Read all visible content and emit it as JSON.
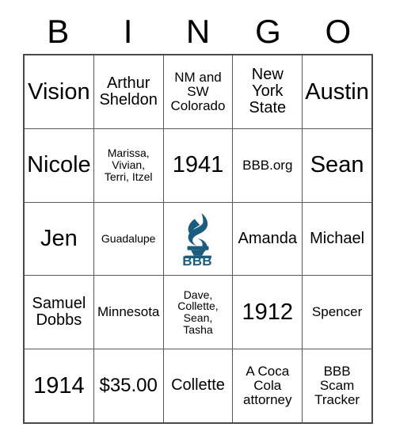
{
  "card": {
    "headers": [
      "B",
      "I",
      "N",
      "G",
      "O"
    ],
    "free_space": {
      "icon": "bbb-torch-logo",
      "wordmark": "BBB",
      "color": "#1b5d80"
    },
    "rows": [
      [
        {
          "text": "Vision",
          "size": "fs-xl"
        },
        {
          "text": "Arthur\nSheldon",
          "size": "fs-md"
        },
        {
          "text": "NM and\nSW\nColorado",
          "size": "fs-sm"
        },
        {
          "text": "New\nYork\nState",
          "size": "fs-md"
        },
        {
          "text": "Austin",
          "size": "fs-xl"
        }
      ],
      [
        {
          "text": "Nicole",
          "size": "fs-xl"
        },
        {
          "text": "Marissa,\nVivian,\nTerri, Itzel",
          "size": "fs-xs"
        },
        {
          "text": "1941",
          "size": "fs-xl"
        },
        {
          "text": "BBB.org",
          "size": "fs-sm"
        },
        {
          "text": "Sean",
          "size": "fs-xl"
        }
      ],
      [
        {
          "text": "Jen",
          "size": "fs-xl"
        },
        {
          "text": "Guadalupe",
          "size": "fs-xs"
        },
        {
          "text": "",
          "size": "free"
        },
        {
          "text": "Amanda",
          "size": "fs-md"
        },
        {
          "text": "Michael",
          "size": "fs-md"
        }
      ],
      [
        {
          "text": "Samuel\nDobbs",
          "size": "fs-md"
        },
        {
          "text": "Minnesota",
          "size": "fs-sm"
        },
        {
          "text": "Dave,\nCollette,\nSean,\nTasha",
          "size": "fs-xs"
        },
        {
          "text": "1912",
          "size": "fs-xl"
        },
        {
          "text": "Spencer",
          "size": "fs-sm"
        }
      ],
      [
        {
          "text": "1914",
          "size": "fs-xl"
        },
        {
          "text": "$35.00",
          "size": "fs-lg"
        },
        {
          "text": "Collette",
          "size": "fs-md"
        },
        {
          "text": "A Coca\nCola\nattorney",
          "size": "fs-sm"
        },
        {
          "text": "BBB\nScam\nTracker",
          "size": "fs-sm"
        }
      ]
    ]
  }
}
